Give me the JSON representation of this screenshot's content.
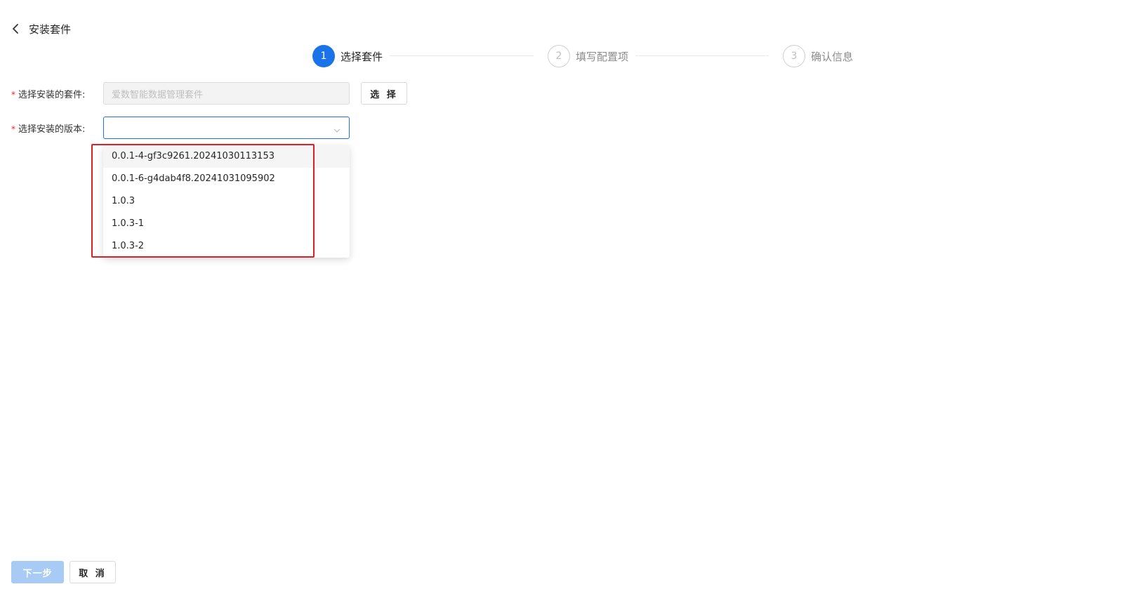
{
  "header": {
    "title": "安装套件"
  },
  "steps": [
    {
      "number": "1",
      "label": "选择套件",
      "state": "active"
    },
    {
      "number": "2",
      "label": "填写配置项",
      "state": "inactive"
    },
    {
      "number": "3",
      "label": "确认信息",
      "state": "inactive"
    }
  ],
  "form": {
    "required_mark": "*",
    "suite": {
      "label": "选择安装的套件:",
      "placeholder": "爱数智能数据管理套件",
      "select_button": "选 择"
    },
    "version": {
      "label": "选择安装的版本:",
      "value": ""
    }
  },
  "dropdown": {
    "options": [
      "0.0.1-4-gf3c9261.20241030113153",
      "0.0.1-6-g4dab4f8.20241031095902",
      "1.0.3",
      "1.0.3-1",
      "1.0.3-2"
    ]
  },
  "footer": {
    "next_label": "下一步",
    "cancel_label": "取 消"
  },
  "colors": {
    "accent": "#1a73e8",
    "highlight": "#e02020",
    "required": "#f5222d",
    "disabled_primary": "#a8cbf5"
  }
}
